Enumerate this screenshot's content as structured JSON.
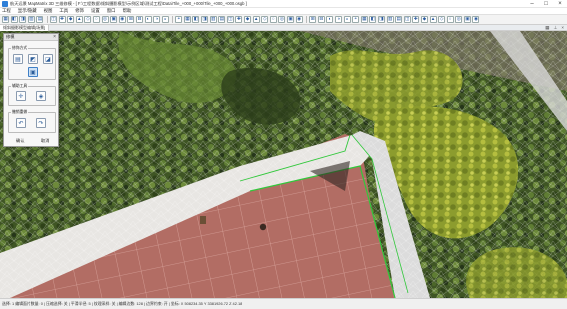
{
  "window": {
    "title": "航天远景 MapMatrix 3D 三维修模 - [ F:\\工程数据\\倾斜摄影模型\\示例区域\\测试工程\\Data\\Tile_+000_+000\\Tile_+000_+000.osgb ]",
    "icon": "app-logo-icon",
    "controls": [
      "minimize-icon",
      "maximize-icon",
      "close-icon"
    ]
  },
  "menubar": {
    "items": [
      "工程",
      "显示/隐藏",
      "视图",
      "工具",
      "修饰",
      "设置",
      "窗口",
      "帮助"
    ]
  },
  "toolbar": {
    "groups": [
      [
        "new-icon",
        "open-icon",
        "save-icon",
        "save-as-icon",
        "undo-icon"
      ],
      [
        "select-icon",
        "box-select-icon",
        "move-icon",
        "rotate-icon",
        "scale-icon",
        "measure-icon",
        "zoom-in-icon",
        "zoom-out-icon",
        "fit-icon",
        "pan-icon",
        "grid-icon",
        "layers-icon",
        "camera-icon",
        "light-icon"
      ],
      [
        "flatten-icon",
        "cut-icon",
        "fill-icon",
        "texture-icon",
        "brush-icon",
        "smooth-icon",
        "triangle-icon",
        "mesh-icon",
        "vertex-icon",
        "edge-icon",
        "face-icon",
        "delete-icon",
        "merge-icon",
        "split-icon",
        "export-icon"
      ],
      [
        "render-icon",
        "wireframe-icon",
        "solid-icon",
        "shade-icon",
        "axis-icon",
        "snap-icon",
        "ortho-icon",
        "top-view-icon",
        "front-view-icon",
        "side-view-icon",
        "perspective-icon",
        "home-icon",
        "refresh-icon",
        "settings-icon",
        "screenshot-icon",
        "info-icon",
        "help-icon",
        "tool-a-icon",
        "tool-b-icon",
        "tool-c-icon"
      ]
    ]
  },
  "subbar": {
    "tab": "倾斜摄影模型编辑[场景]",
    "right_icons": [
      "tile-icon",
      "pin-icon",
      "close-icon"
    ]
  },
  "panel": {
    "title": "修模",
    "groups": [
      {
        "label": "修饰方式",
        "buttons": [
          "flatten-mode-icon",
          "bridge-mode-icon",
          "cut-mode-icon",
          "fill-mode-icon"
        ]
      },
      {
        "label": "辅助工具",
        "buttons": [
          "pick-point-icon",
          "texture-sample-icon"
        ]
      },
      {
        "label": "撤销重做",
        "buttons": [
          "undo-icon",
          "redo-icon"
        ]
      }
    ],
    "footer": [
      "确认",
      "取消"
    ]
  },
  "status": {
    "text": "选择: 1 编辑面片数量: 0 | 压缩选择: 关 | 平滑半径: 5 | 纹理采样: 关 | 编辑边数: 128 | 边界约束: 开 | 坐标: X 508234.35 Y 3381926.72 Z 42.18"
  },
  "colors": {
    "accent": "#2f7fd8",
    "selection": "#31c83b",
    "roof": "#a9615a",
    "vegetation": "#4f6a2c"
  }
}
